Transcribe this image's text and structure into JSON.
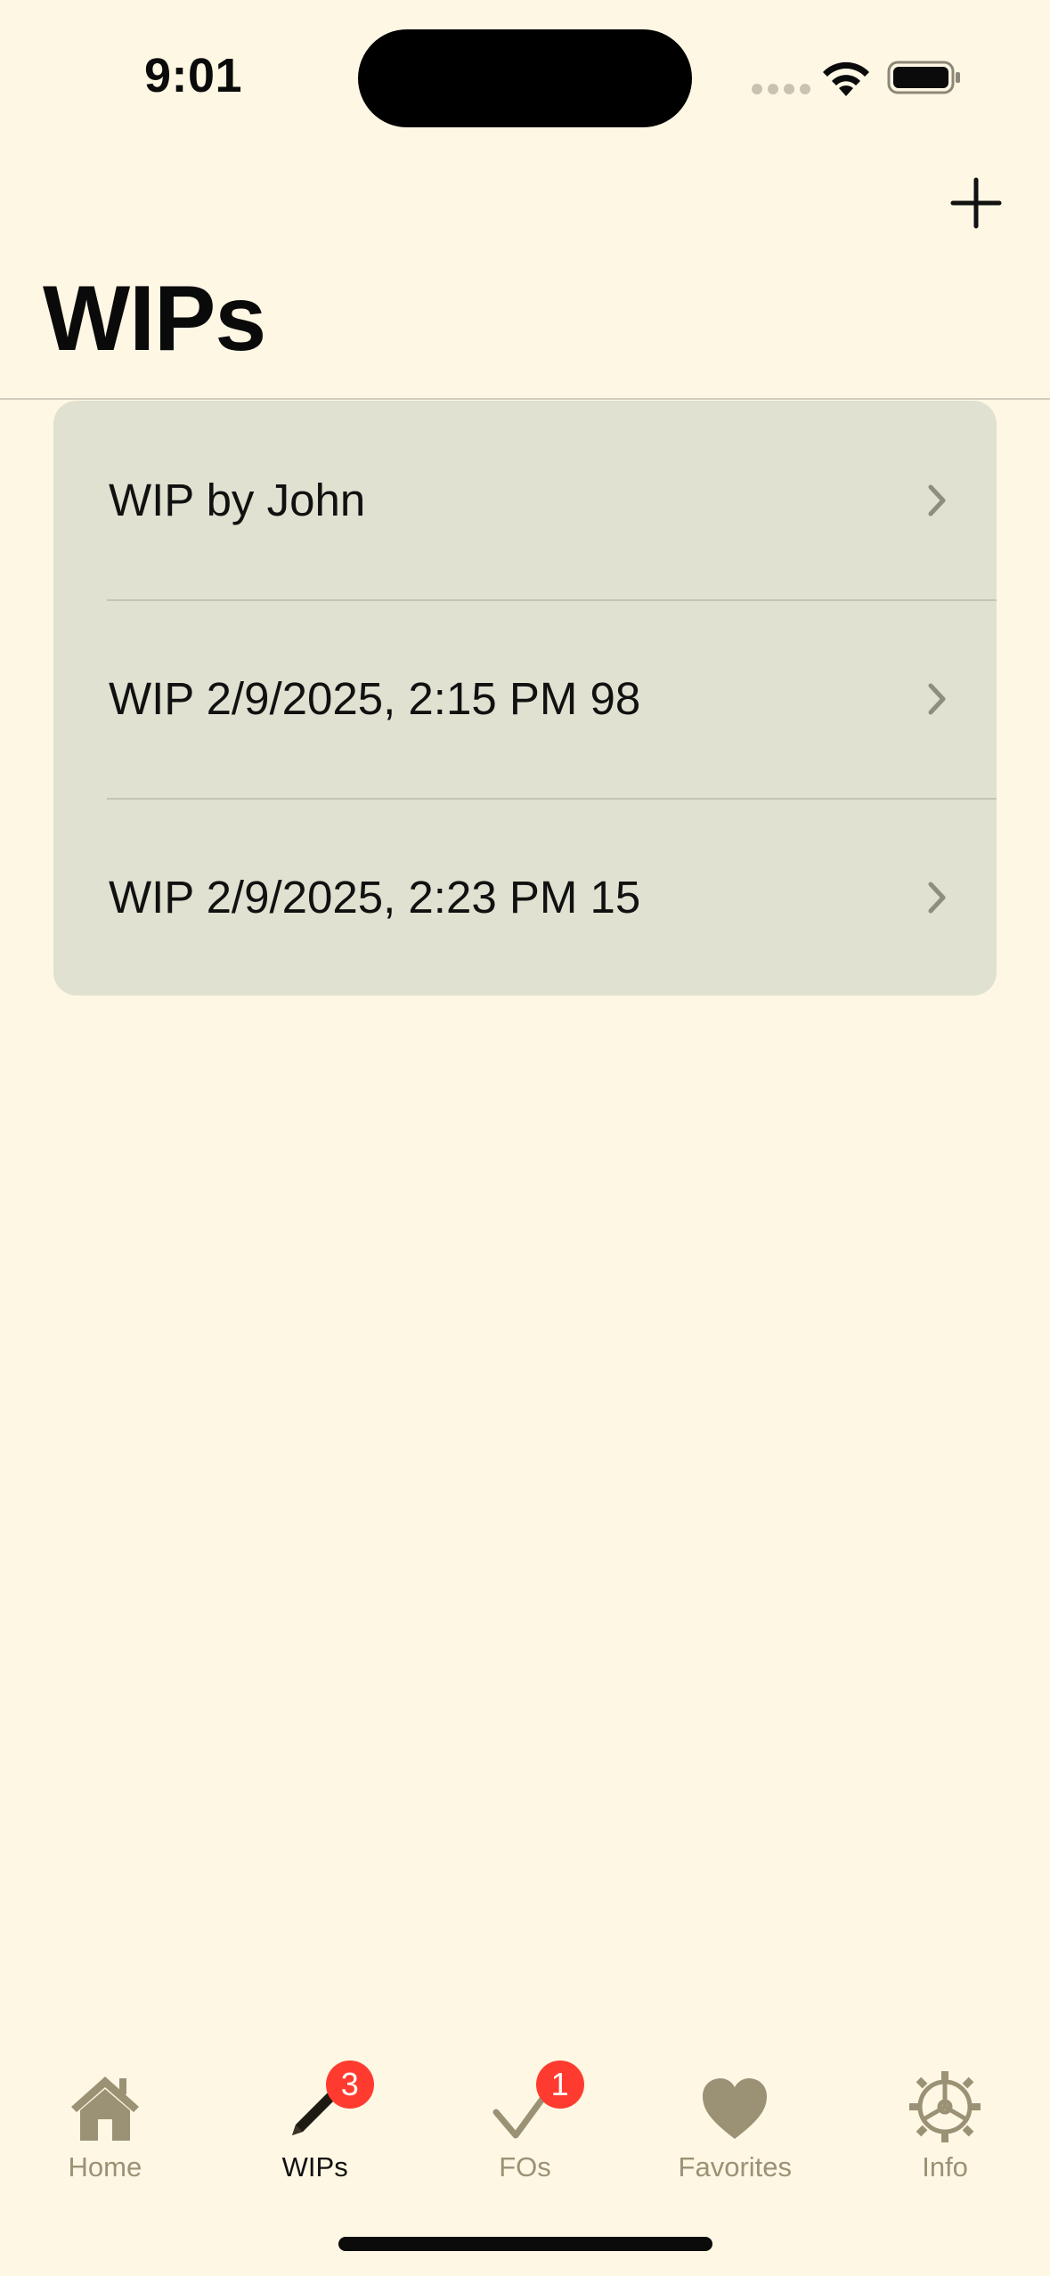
{
  "status_bar": {
    "time": "9:01"
  },
  "nav": {
    "title": "WIPs",
    "add_icon": "plus-icon"
  },
  "list": {
    "items": [
      {
        "label": "WIP by John"
      },
      {
        "label": "WIP 2/9/2025, 2:15 PM 98"
      },
      {
        "label": "WIP 2/9/2025, 2:23 PM 15"
      }
    ]
  },
  "tab_bar": {
    "tabs": [
      {
        "label": "Home",
        "icon": "house-icon",
        "active": false,
        "badge": null
      },
      {
        "label": "WIPs",
        "icon": "pencil-icon",
        "active": true,
        "badge": "3"
      },
      {
        "label": "FOs",
        "icon": "checkmark-icon",
        "active": false,
        "badge": "1"
      },
      {
        "label": "Favorites",
        "icon": "heart-icon",
        "active": false,
        "badge": null
      },
      {
        "label": "Info",
        "icon": "gear-icon",
        "active": false,
        "badge": null
      }
    ]
  },
  "colors": {
    "background": "#FEF7E4",
    "list_background": "#E0E1D0",
    "tab_inactive": "#9B9275",
    "badge": "#FF3B30"
  }
}
